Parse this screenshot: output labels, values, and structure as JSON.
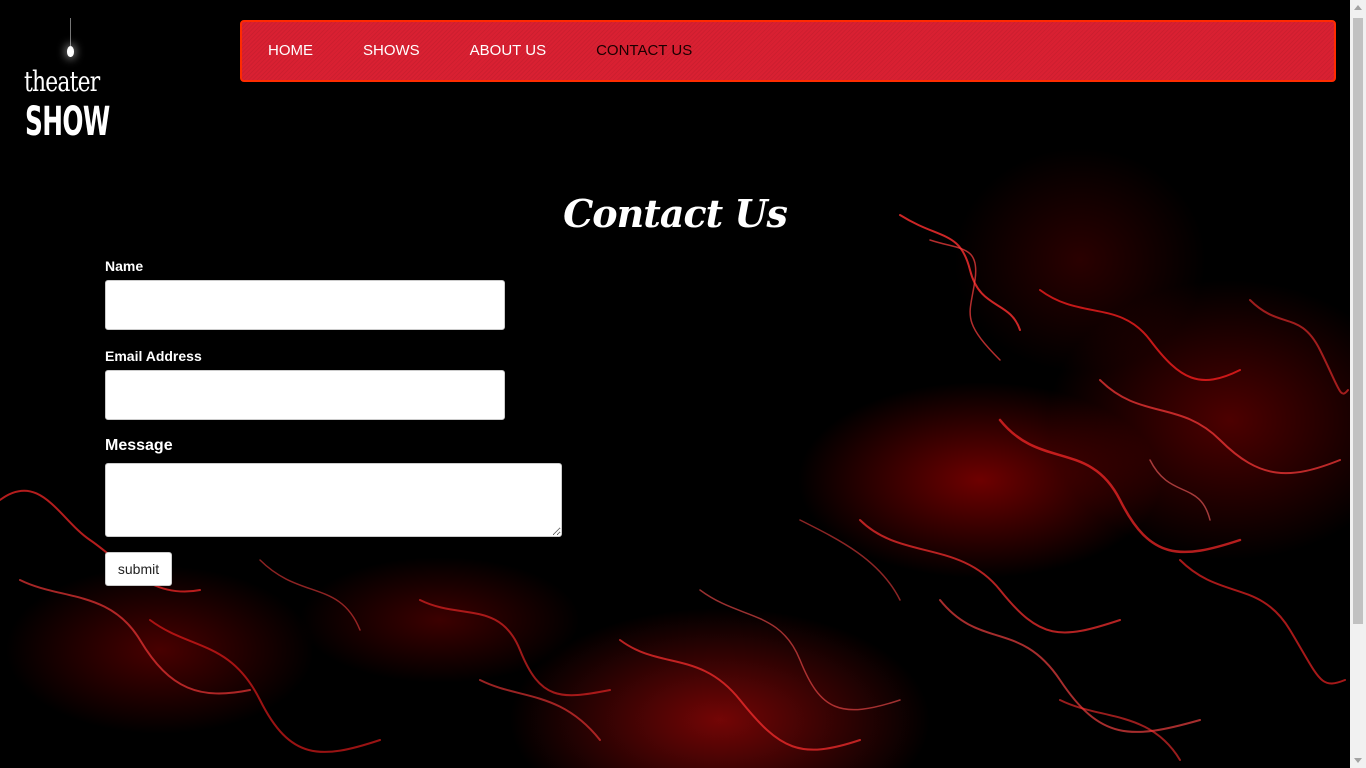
{
  "logo": {
    "line1": "theater",
    "line2": "SHOW"
  },
  "nav": {
    "items": [
      {
        "label": "HOME",
        "active": false
      },
      {
        "label": "SHOWS",
        "active": false
      },
      {
        "label": "ABOUT US",
        "active": false
      },
      {
        "label": "CONTACT US",
        "active": true
      }
    ]
  },
  "page_title": "Contact Us",
  "form": {
    "name_label": "Name",
    "name_value": "",
    "email_label": "Email Address",
    "email_value": "",
    "message_label": "Message",
    "message_value": "",
    "submit_label": "submit"
  },
  "colors": {
    "nav_background": "#d92032",
    "nav_border": "#ff2b00",
    "accent_red": "#e01010",
    "background": "#000000"
  }
}
